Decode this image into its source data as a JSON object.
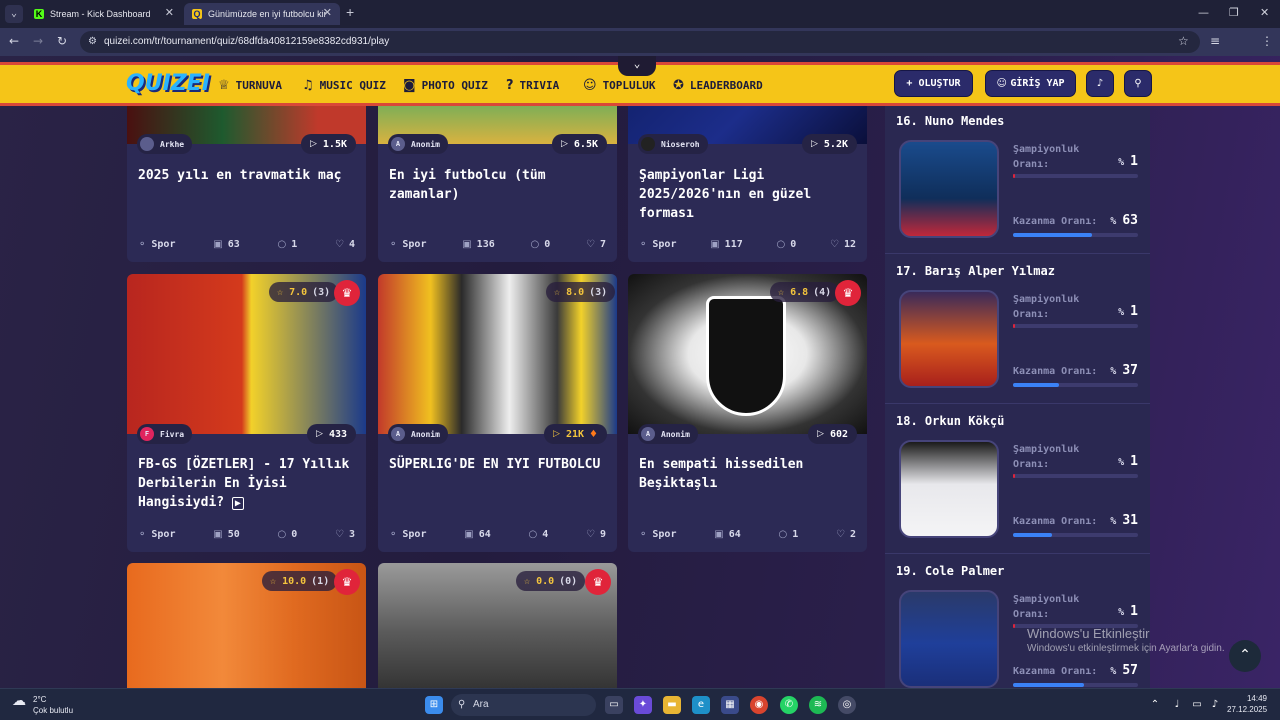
{
  "browser": {
    "tabs": [
      {
        "title": "Stream - Kick Dashboard"
      },
      {
        "title": "Günümüzde en iyi futbolcu kim"
      }
    ],
    "url": "quizei.com/tr/tournament/quiz/68dfda40812159e8382cd931/play"
  },
  "site": {
    "logo": "QUIZEI",
    "nav": [
      {
        "label": "TURNUVA",
        "icon": "trophy-icon"
      },
      {
        "label": "MUSIC QUIZ",
        "icon": "music-icon"
      },
      {
        "label": "PHOTO QUIZ",
        "icon": "camera-icon"
      },
      {
        "label": "TRIVIA",
        "icon": "question-icon"
      },
      {
        "label": "TOPLULUK",
        "icon": "users-icon"
      },
      {
        "label": "LEADERBOARD",
        "icon": "award-icon"
      }
    ],
    "create_label": "OLUŞTUR",
    "login_label": "GİRİŞ YAP"
  },
  "cards": [
    {
      "author": "Arkhe",
      "plays": "1.5K",
      "title": "2025 yılı en travmatik maç",
      "category": "Spor",
      "questions": "63",
      "comments": "1",
      "likes": "4"
    },
    {
      "author": "Anonim",
      "plays": "6.5K",
      "title": "En iyi futbolcu (tüm zamanlar)",
      "category": "Spor",
      "questions": "136",
      "comments": "0",
      "likes": "7"
    },
    {
      "author": "Nioseroh",
      "plays": "5.2K",
      "title": "Şampiyonlar Ligi 2025/2026'nın en güzel forması",
      "category": "Spor",
      "questions": "117",
      "comments": "0",
      "likes": "12"
    },
    {
      "author": "Fivra",
      "plays": "433",
      "rating": "7.0",
      "rating_count": "(3)",
      "title": "FB-GS [ÖZETLER] - 17 Yıllık Derbilerin En İyisi Hangisiydi?",
      "category": "Spor",
      "questions": "50",
      "comments": "0",
      "likes": "3"
    },
    {
      "author": "Anonim",
      "plays": "21K",
      "rating": "8.0",
      "rating_count": "(3)",
      "title": "SÜPERLIG'DE EN IYI FUTBOLCU",
      "category": "Spor",
      "questions": "64",
      "comments": "4",
      "likes": "9"
    },
    {
      "author": "Anonim",
      "plays": "602",
      "rating": "6.8",
      "rating_count": "(4)",
      "title": "En sempati hissedilen Beşiktaşlı",
      "category": "Spor",
      "questions": "64",
      "comments": "1",
      "likes": "2"
    },
    {
      "rating": "10.0",
      "rating_count": "(1)"
    },
    {
      "rating": "0.0",
      "rating_count": "(0)"
    }
  ],
  "leaderboard": {
    "champ_label": "Şampiyonluk Oranı:",
    "win_label": "Kazanma Oranı:",
    "percent_sign": "%",
    "players": [
      {
        "name": "16. Nuno Mendes",
        "champ": "1",
        "win": "63",
        "win_fraction": 0.63
      },
      {
        "name": "17. Barış Alper Yılmaz",
        "champ": "1",
        "win": "37",
        "win_fraction": 0.37
      },
      {
        "name": "18. Orkun Kökçü",
        "champ": "1",
        "win": "31",
        "win_fraction": 0.31
      },
      {
        "name": "19. Cole Palmer",
        "champ": "1",
        "win": "57",
        "win_fraction": 0.57
      }
    ]
  },
  "overlay": {
    "activate_title": "Windows'u Etkinleştir",
    "activate_sub": "Windows'u etkinleştirmek için Ayarlar'a gidin."
  },
  "taskbar": {
    "temp": "2°C",
    "weather": "Çok bulutlu",
    "search": "Ara",
    "time": "14:49",
    "date": "27.12.2025"
  }
}
